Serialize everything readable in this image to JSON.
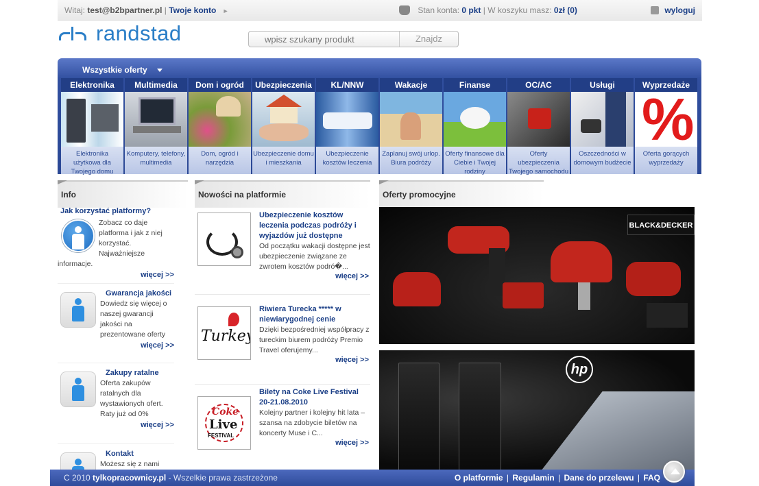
{
  "topbar": {
    "welcome_prefix": "Witaj:",
    "user_email": "test@b2bpartner.pl",
    "separator": "|",
    "account_link": "Twoje konto",
    "balance_label": "Stan konta:",
    "balance_value": "0 pkt",
    "cart_label": "| W koszyku masz:",
    "cart_value": "0zł (0)",
    "logout": "wyloguj"
  },
  "logo": {
    "name": "randstad"
  },
  "search": {
    "placeholder": "wpisz szukany produkt",
    "button": "Znajdz"
  },
  "nav": {
    "all_offers": "Wszystkie oferty",
    "categories": [
      {
        "title": "Elektronika",
        "desc": "Elektronika użytkowa dla Twojego domu"
      },
      {
        "title": "Multimedia",
        "desc": "Komputery, telefony, multimedia"
      },
      {
        "title": "Dom i ogród",
        "desc": "Dom, ogród i narzędzia"
      },
      {
        "title": "Ubezpieczenia",
        "desc": "Ubezpieczenie domu i mieszkania"
      },
      {
        "title": "KL/NNW",
        "desc": "Ubezpieczenie kosztów leczenia"
      },
      {
        "title": "Wakacje",
        "desc": "Zaplanuj swój urlop. Biura podróży"
      },
      {
        "title": "Finanse",
        "desc": "Oferty finansowe dla Ciebie i Twojej rodziny"
      },
      {
        "title": "OC/AC",
        "desc": "Oferty ubezpieczenia Twojego samochodu"
      },
      {
        "title": "Usługi",
        "desc": "Oszczedności w domowym budżecie"
      },
      {
        "title": "Wyprzedaże",
        "desc": "Oferta gorących wyprzedaży"
      }
    ]
  },
  "info": {
    "title": "Info",
    "items": [
      {
        "heading": "Jak korzystać platformy?",
        "body": "Zobacz co daje platforma i jak z niej korzystać. Najważniejsze informacje.",
        "more": "więcej >>"
      },
      {
        "heading": "Gwarancja jakości",
        "body": "Dowiedz się więcej o naszej gwarancji jakości na prezentowane oferty",
        "more": "więcej >>"
      },
      {
        "heading": "Zakupy ratalne",
        "body": "Oferta zakupów ratalnych dla wystawionych ofert. Raty już od 0%",
        "more": "więcej >>"
      },
      {
        "heading": "Kontakt",
        "body": "Możesz się z nami",
        "more": ""
      }
    ]
  },
  "news": {
    "title": "Nowości na platformie",
    "items": [
      {
        "heading": "Ubezpieczenie kosztów leczenia podczas podróży i wyjazdów już dostępne",
        "body": "Od początku wakacji dostępne jest ubezpieczenie związane ze zwrotem kosztów podró�...",
        "more": "więcej >>"
      },
      {
        "heading": "Riwiera Turecka ***** w niewiarygodnej cenie",
        "body": "Dzięki bezpośredniej współpracy z tureckim biurem podróży Premio Travel oferujemy...",
        "more": "więcej >>"
      },
      {
        "heading": "Bilety na Coke Live Festival 20-21.08.2010",
        "body": "Kolejny partner i kolejny hit lata – szansa na zdobycie biletów na koncerty Muse i C...",
        "more": "więcej >>"
      }
    ],
    "logo_texts": {
      "turkey": "Turkey",
      "coke": "Coke",
      "live": "Live",
      "festival": "FESTIVAL"
    }
  },
  "promo": {
    "title": "Oferty promocyjne",
    "banner1_brand": "BLACK&DECKER",
    "banner2_brand": "hp"
  },
  "footer": {
    "copy_prefix": "C 2010",
    "site": "tylkopracownicy.pl",
    "copy_suffix": "- Wszelkie prawa zastrzeżone",
    "links": [
      "O platformie",
      "Regulamin",
      "Dane do przelewu",
      "FAQ"
    ]
  }
}
